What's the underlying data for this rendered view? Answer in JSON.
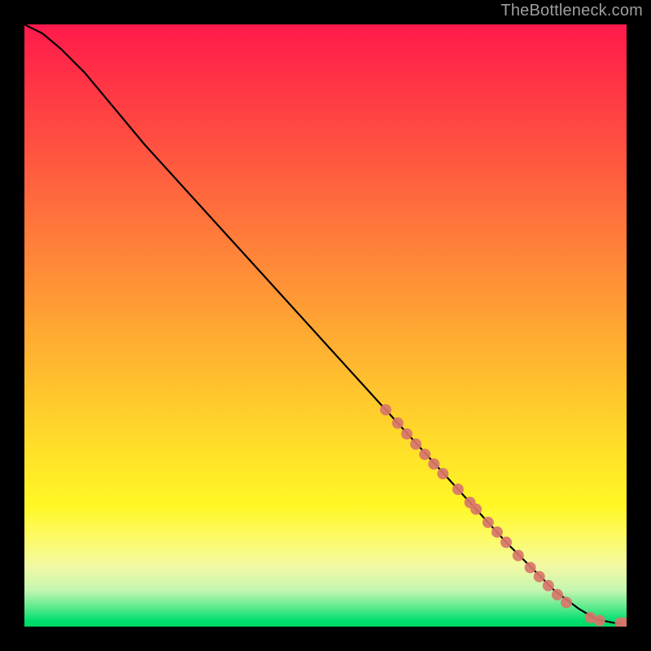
{
  "attribution": "TheBottleneck.com",
  "chart_data": {
    "type": "line",
    "title": "",
    "xlabel": "",
    "ylabel": "",
    "xlim": [
      0,
      100
    ],
    "ylim": [
      0,
      100
    ],
    "grid": false,
    "legend": false,
    "series": [
      {
        "name": "curve",
        "style": "line",
        "color": "#000000",
        "x": [
          0,
          3,
          6,
          10,
          15,
          20,
          30,
          40,
          50,
          60,
          70,
          80,
          88,
          92,
          95,
          98,
          100
        ],
        "y": [
          100,
          98.5,
          96,
          92,
          86,
          80,
          69,
          58,
          47,
          36,
          25,
          14,
          6,
          3,
          1.2,
          0.6,
          0.6
        ]
      },
      {
        "name": "markers",
        "style": "scatter",
        "color": "#d8766a",
        "x": [
          60,
          62,
          63.5,
          65,
          66.5,
          68,
          69.5,
          72,
          74,
          75,
          77,
          78.5,
          80,
          82,
          84,
          85.5,
          87,
          88.5,
          90,
          94,
          95.5,
          99,
          100
        ],
        "y": [
          36,
          33.8,
          32,
          30.3,
          28.6,
          27,
          25.4,
          22.8,
          20.6,
          19.5,
          17.3,
          15.7,
          14,
          11.8,
          9.8,
          8.3,
          6.8,
          5.3,
          4,
          1.5,
          1.0,
          0.6,
          0.6
        ]
      }
    ],
    "gradient_stops": [
      {
        "pos": 0.0,
        "color": "#ff1a4c"
      },
      {
        "pos": 0.22,
        "color": "#ff5640"
      },
      {
        "pos": 0.48,
        "color": "#ffa034"
      },
      {
        "pos": 0.72,
        "color": "#ffe428"
      },
      {
        "pos": 0.9,
        "color": "#f2f9a4"
      },
      {
        "pos": 0.99,
        "color": "#00e070"
      }
    ]
  }
}
